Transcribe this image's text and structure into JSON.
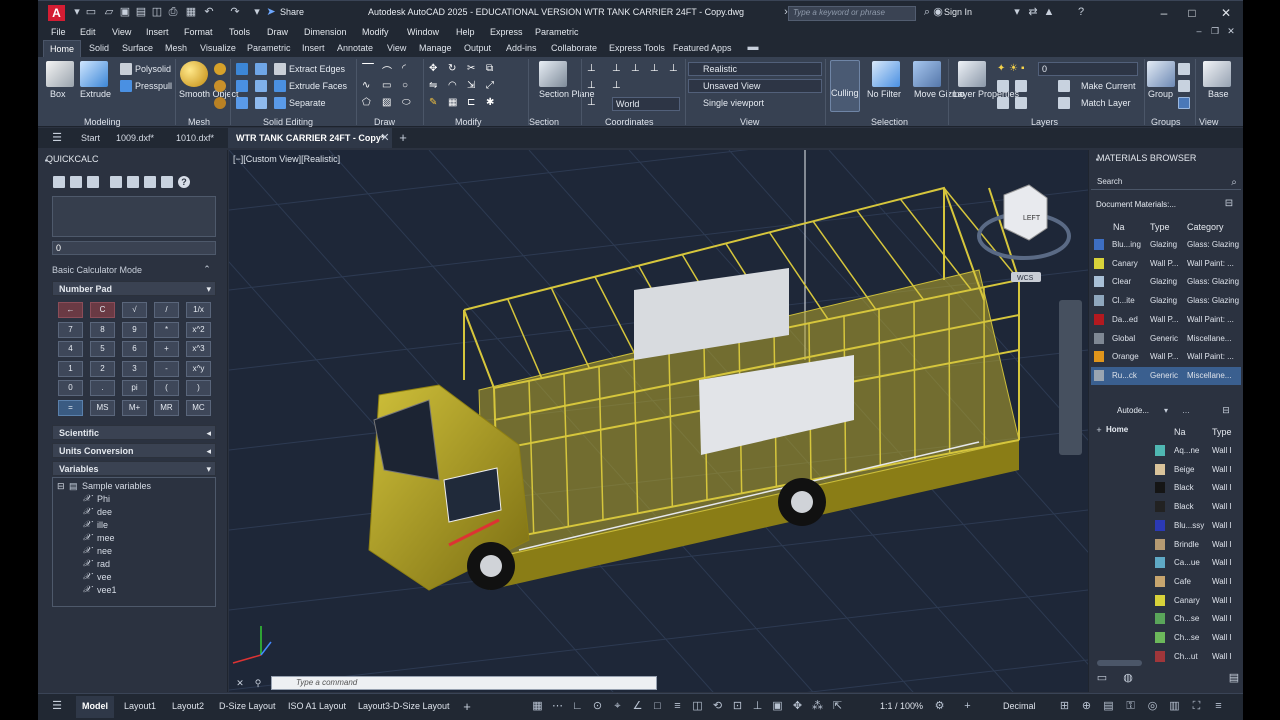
{
  "titlebar": {
    "app_letter": "A",
    "share": "Share",
    "title": "Autodesk AutoCAD 2025 - EDUCATIONAL VERSION    WTR TANK CARRIER 24FT - Copy.dwg",
    "search_placeholder": "Type a keyword or phrase",
    "signin": "Sign In"
  },
  "menu": [
    "File",
    "Edit",
    "View",
    "Insert",
    "Format",
    "Tools",
    "Draw",
    "Dimension",
    "Modify",
    "Window",
    "Help",
    "Express",
    "Parametric"
  ],
  "ribbon_tabs": [
    "Home",
    "Solid",
    "Surface",
    "Mesh",
    "Visualize",
    "Parametric",
    "Insert",
    "Annotate",
    "View",
    "Manage",
    "Output",
    "Add-ins",
    "Collaborate",
    "Express Tools",
    "Featured Apps"
  ],
  "ribbon": {
    "modeling": {
      "label": "Modeling",
      "box": "Box",
      "extrude": "Extrude",
      "polysolid": "Polysolid",
      "presspull": "Presspull"
    },
    "mesh": {
      "label": "Mesh",
      "smooth_object": "Smooth Object"
    },
    "solid_editing": {
      "label": "Solid Editing",
      "extract_edges": "Extract Edges",
      "extrude_faces": "Extrude Faces",
      "separate": "Separate"
    },
    "draw": {
      "label": "Draw"
    },
    "modify": {
      "label": "Modify"
    },
    "section": {
      "label": "Section",
      "section_plane": "Section Plane"
    },
    "coordinates": {
      "label": "Coordinates",
      "world": "World"
    },
    "view": {
      "label": "View",
      "visual_style": "Realistic",
      "named_view": "Unsaved View",
      "viewport": "Single viewport"
    },
    "selection": {
      "label": "Selection",
      "culling": "Culling",
      "no_filter": "No Filter",
      "move_gizmo": "Move Gizmo"
    },
    "layers": {
      "label": "Layers",
      "layer_properties": "Layer Properties",
      "layer_name": "0",
      "make_current": "Make Current",
      "match_layer": "Match Layer"
    },
    "groups": {
      "label": "Groups",
      "group": "Group"
    },
    "view2": {
      "label": "View",
      "base": "Base"
    }
  },
  "file_tabs": [
    "Start",
    "1009.dxf*",
    "1010.dxf*",
    "WTR TANK CARRIER 24FT - Copy*"
  ],
  "quickcalc": {
    "title": "QUICKCALC",
    "input_value": "0",
    "mode": "Basic Calculator Mode",
    "number_pad": "Number Pad",
    "keys": [
      "←",
      "C",
      "√",
      "/",
      "1/x",
      "7",
      "8",
      "9",
      "*",
      "x^2",
      "4",
      "5",
      "6",
      "+",
      "x^3",
      "1",
      "2",
      "3",
      "-",
      "x^y",
      "0",
      ".",
      "pi",
      "(",
      ")",
      "=",
      "MS",
      "M+",
      "MR",
      "MC"
    ],
    "scientific": "Scientific",
    "units_conversion": "Units Conversion",
    "variables": "Variables",
    "sample_variables": "Sample variables",
    "var_list": [
      "Phi",
      "dee",
      "ille",
      "mee",
      "nee",
      "rad",
      "vee",
      "vee1"
    ]
  },
  "viewport": {
    "label": "[−][Custom View][Realistic]",
    "wcs": "WCS",
    "cube_face": "LEFT",
    "command_placeholder": "Type a command"
  },
  "materials": {
    "title": "MATERIALS BROWSER",
    "search": "Search",
    "doc_materials": "Document Materials:...",
    "cols": [
      "Na",
      "Type",
      "Category"
    ],
    "rows": [
      {
        "name": "Blu...ing",
        "type": "Glazing",
        "cat": "Glass: Glazing",
        "color": "#3d6ec2"
      },
      {
        "name": "Canary",
        "type": "Wall P...",
        "cat": "Wall Paint: ...",
        "color": "#d8d23a"
      },
      {
        "name": "Clear",
        "type": "Glazing",
        "cat": "Glass: Glazing",
        "color": "#a9c0d6"
      },
      {
        "name": "Cl...ite",
        "type": "Glazing",
        "cat": "Glass: Glazing",
        "color": "#8fa7bd"
      },
      {
        "name": "Da...ed",
        "type": "Wall P...",
        "cat": "Wall Paint: ...",
        "color": "#b3191f"
      },
      {
        "name": "Global",
        "type": "Generic",
        "cat": "Miscellane...",
        "color": "#7f8894"
      },
      {
        "name": "Orange",
        "type": "Wall P...",
        "cat": "Wall Paint: ...",
        "color": "#e0951b"
      },
      {
        "name": "Ru...ck",
        "type": "Generic",
        "cat": "Miscellane...",
        "color": "#9aa5b1"
      }
    ],
    "lib_dropdown": "Autode...",
    "home": "Home",
    "lib_cols": [
      "Na",
      "Type"
    ],
    "lib_rows": [
      {
        "name": "Aq...ne",
        "type": "Wall I",
        "color": "#4fb7b2"
      },
      {
        "name": "Beige",
        "type": "Wall I",
        "color": "#d9c39a"
      },
      {
        "name": "Black",
        "type": "Wall I",
        "color": "#151515"
      },
      {
        "name": "Black",
        "type": "Wall I",
        "color": "#222222"
      },
      {
        "name": "Blu...ssy",
        "type": "Wall I",
        "color": "#2b39b5"
      },
      {
        "name": "Brindle",
        "type": "Wall I",
        "color": "#b59a72"
      },
      {
        "name": "Ca...ue",
        "type": "Wall I",
        "color": "#5fa9c5"
      },
      {
        "name": "Cafe",
        "type": "Wall I",
        "color": "#c7a56e"
      },
      {
        "name": "Canary",
        "type": "Wall I",
        "color": "#d8d23a"
      },
      {
        "name": "Ch...se",
        "type": "Wall I",
        "color": "#5aa55a"
      },
      {
        "name": "Ch...se",
        "type": "Wall I",
        "color": "#6cb85b"
      },
      {
        "name": "Ch...ut",
        "type": "Wall I",
        "color": "#a0363a"
      }
    ]
  },
  "statusbar": {
    "tabs": [
      "Model",
      "Layout1",
      "Layout2",
      "D-Size Layout",
      "ISO A1 Layout",
      "Layout3-D-Size Layout"
    ],
    "scale": "1:1 / 100%",
    "units": "Decimal"
  },
  "colors": {
    "accent": "#3a5f8f",
    "truck": "#b8a82a",
    "autocad_red": "#d41d33"
  }
}
